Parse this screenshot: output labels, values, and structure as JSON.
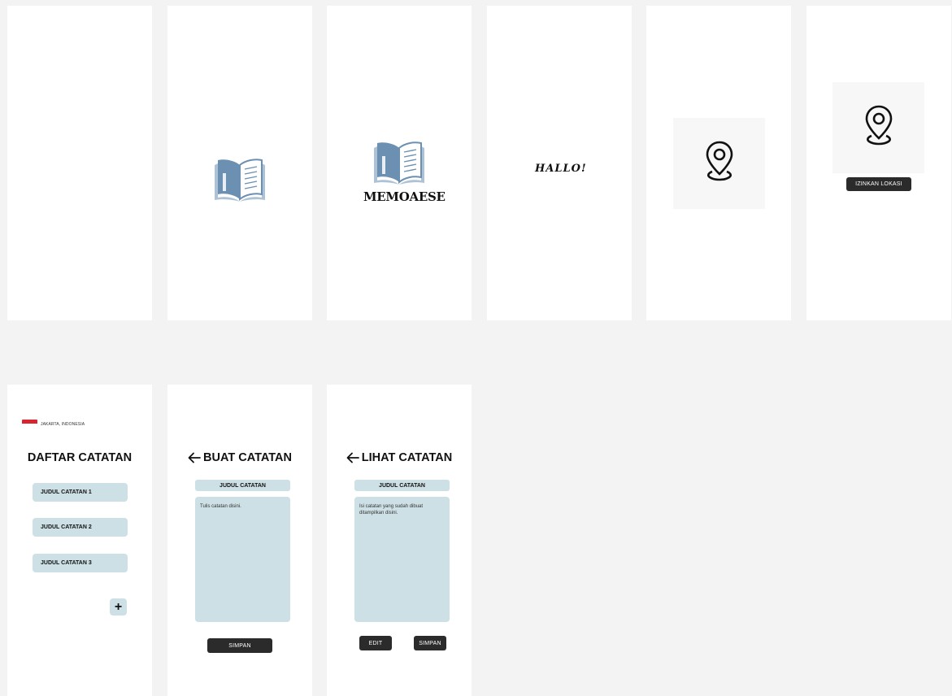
{
  "colors": {
    "canvas": "#f3f3f3",
    "frame": "#ffffff",
    "accent_blue": "#6b90b2",
    "field_bg": "#cde0e5",
    "button_dark": "#2b2b2b",
    "flag_red": "#d9232e"
  },
  "splash_logo": {
    "icon": "open-book-icon"
  },
  "splash_brand": {
    "icon": "open-book-icon",
    "name": "MEMOAESE"
  },
  "greeting": {
    "text": "HALLO!"
  },
  "location_prompt": {
    "icon": "location-pin-icon"
  },
  "location_permission": {
    "icon": "location-pin-icon",
    "button_label": "IZINKAN LOKASI"
  },
  "note_list": {
    "flag_icon": "indonesia-flag-icon",
    "location": "JAKARTA, INDONESIA",
    "title": "DAFTAR CATATAN",
    "items": [
      "JUDUL CATATAN 1",
      "JUDUL CATATAN 2",
      "JUDUL CATATAN 3"
    ],
    "add_icon": "plus-icon",
    "add_label": "+"
  },
  "create_note": {
    "back_icon": "arrow-left-icon",
    "title": "BUAT CATATAN",
    "title_field": "JUDUL CATATAN",
    "body_placeholder": "Tulis catatan disini.",
    "save_label": "SIMPAN"
  },
  "view_note": {
    "back_icon": "arrow-left-icon",
    "title": "LIHAT CATATAN",
    "title_field": "JUDUL CATATAN",
    "body_text": "Isi catatan yang sudah dibuat ditampilkan disini.",
    "edit_label": "EDIT",
    "save_label": "SIMPAN"
  }
}
